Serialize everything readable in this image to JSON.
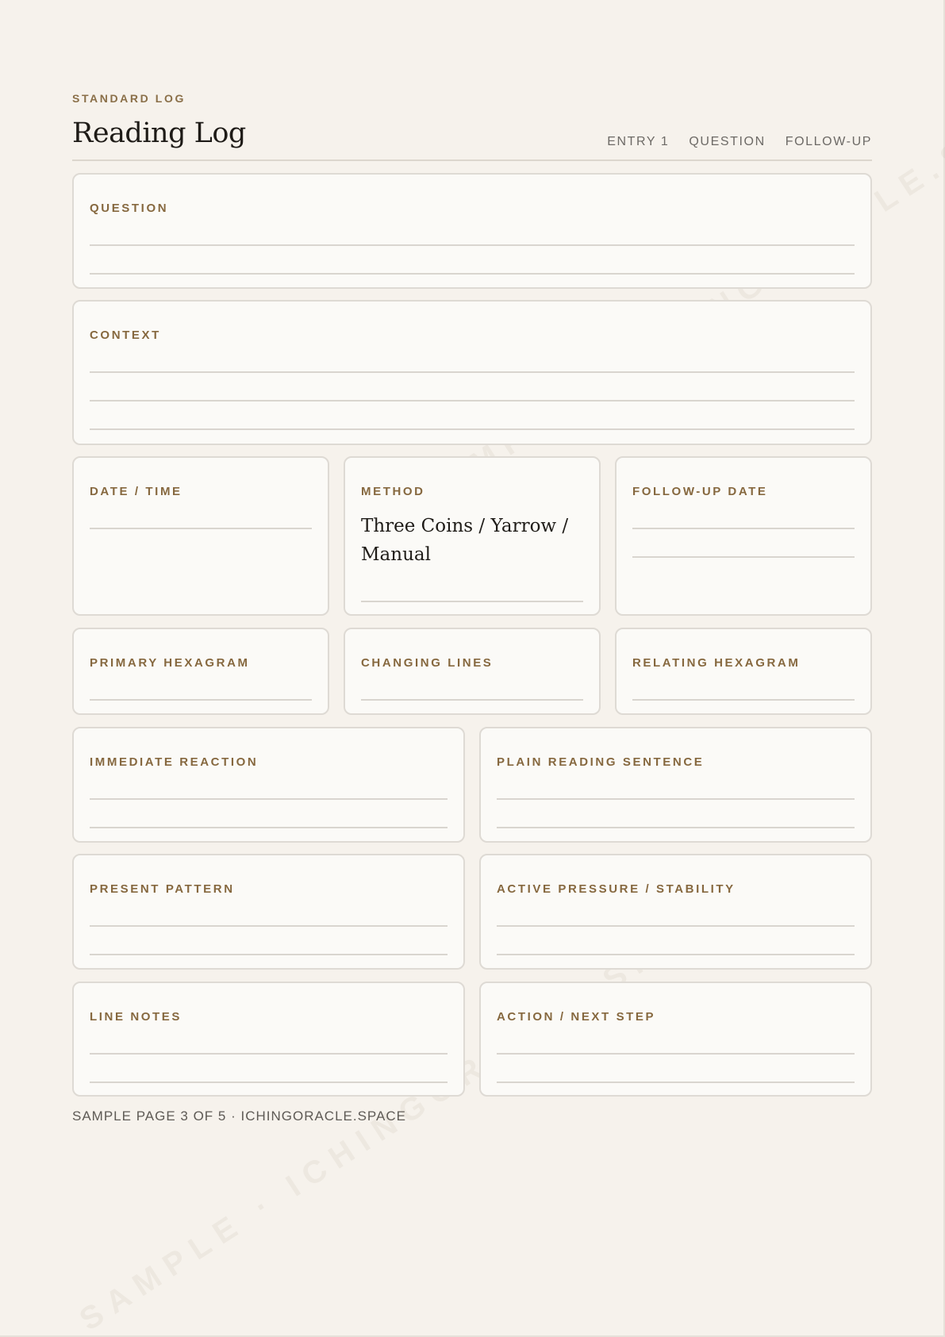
{
  "header": {
    "kicker": "STANDARD LOG",
    "title": "Reading Log",
    "nav": [
      "ENTRY 1",
      "QUESTION",
      "FOLLOW-UP"
    ]
  },
  "fields": {
    "question": "QUESTION",
    "context": "CONTEXT",
    "date_time": "DATE / TIME",
    "method": "METHOD",
    "method_value": "Three Coins / Yarrow / Manual",
    "follow_up_date": "FOLLOW-UP DATE",
    "primary_hexagram": "PRIMARY HEXAGRAM",
    "changing_lines": "CHANGING LINES",
    "relating_hexagram": "RELATING HEXAGRAM",
    "immediate_reaction": "IMMEDIATE REACTION",
    "plain_reading_sentence": "PLAIN READING SENTENCE",
    "present_pattern": "PRESENT PATTERN",
    "active_pressure_stability": "ACTIVE PRESSURE / STABILITY",
    "line_notes": "LINE NOTES",
    "action_next_step": "ACTION / NEXT STEP"
  },
  "footer": "SAMPLE PAGE 3 OF 5 · ICHINGORACLE.SPACE",
  "watermark": "SAMPLE · ICHINGORACLE.SPACE"
}
